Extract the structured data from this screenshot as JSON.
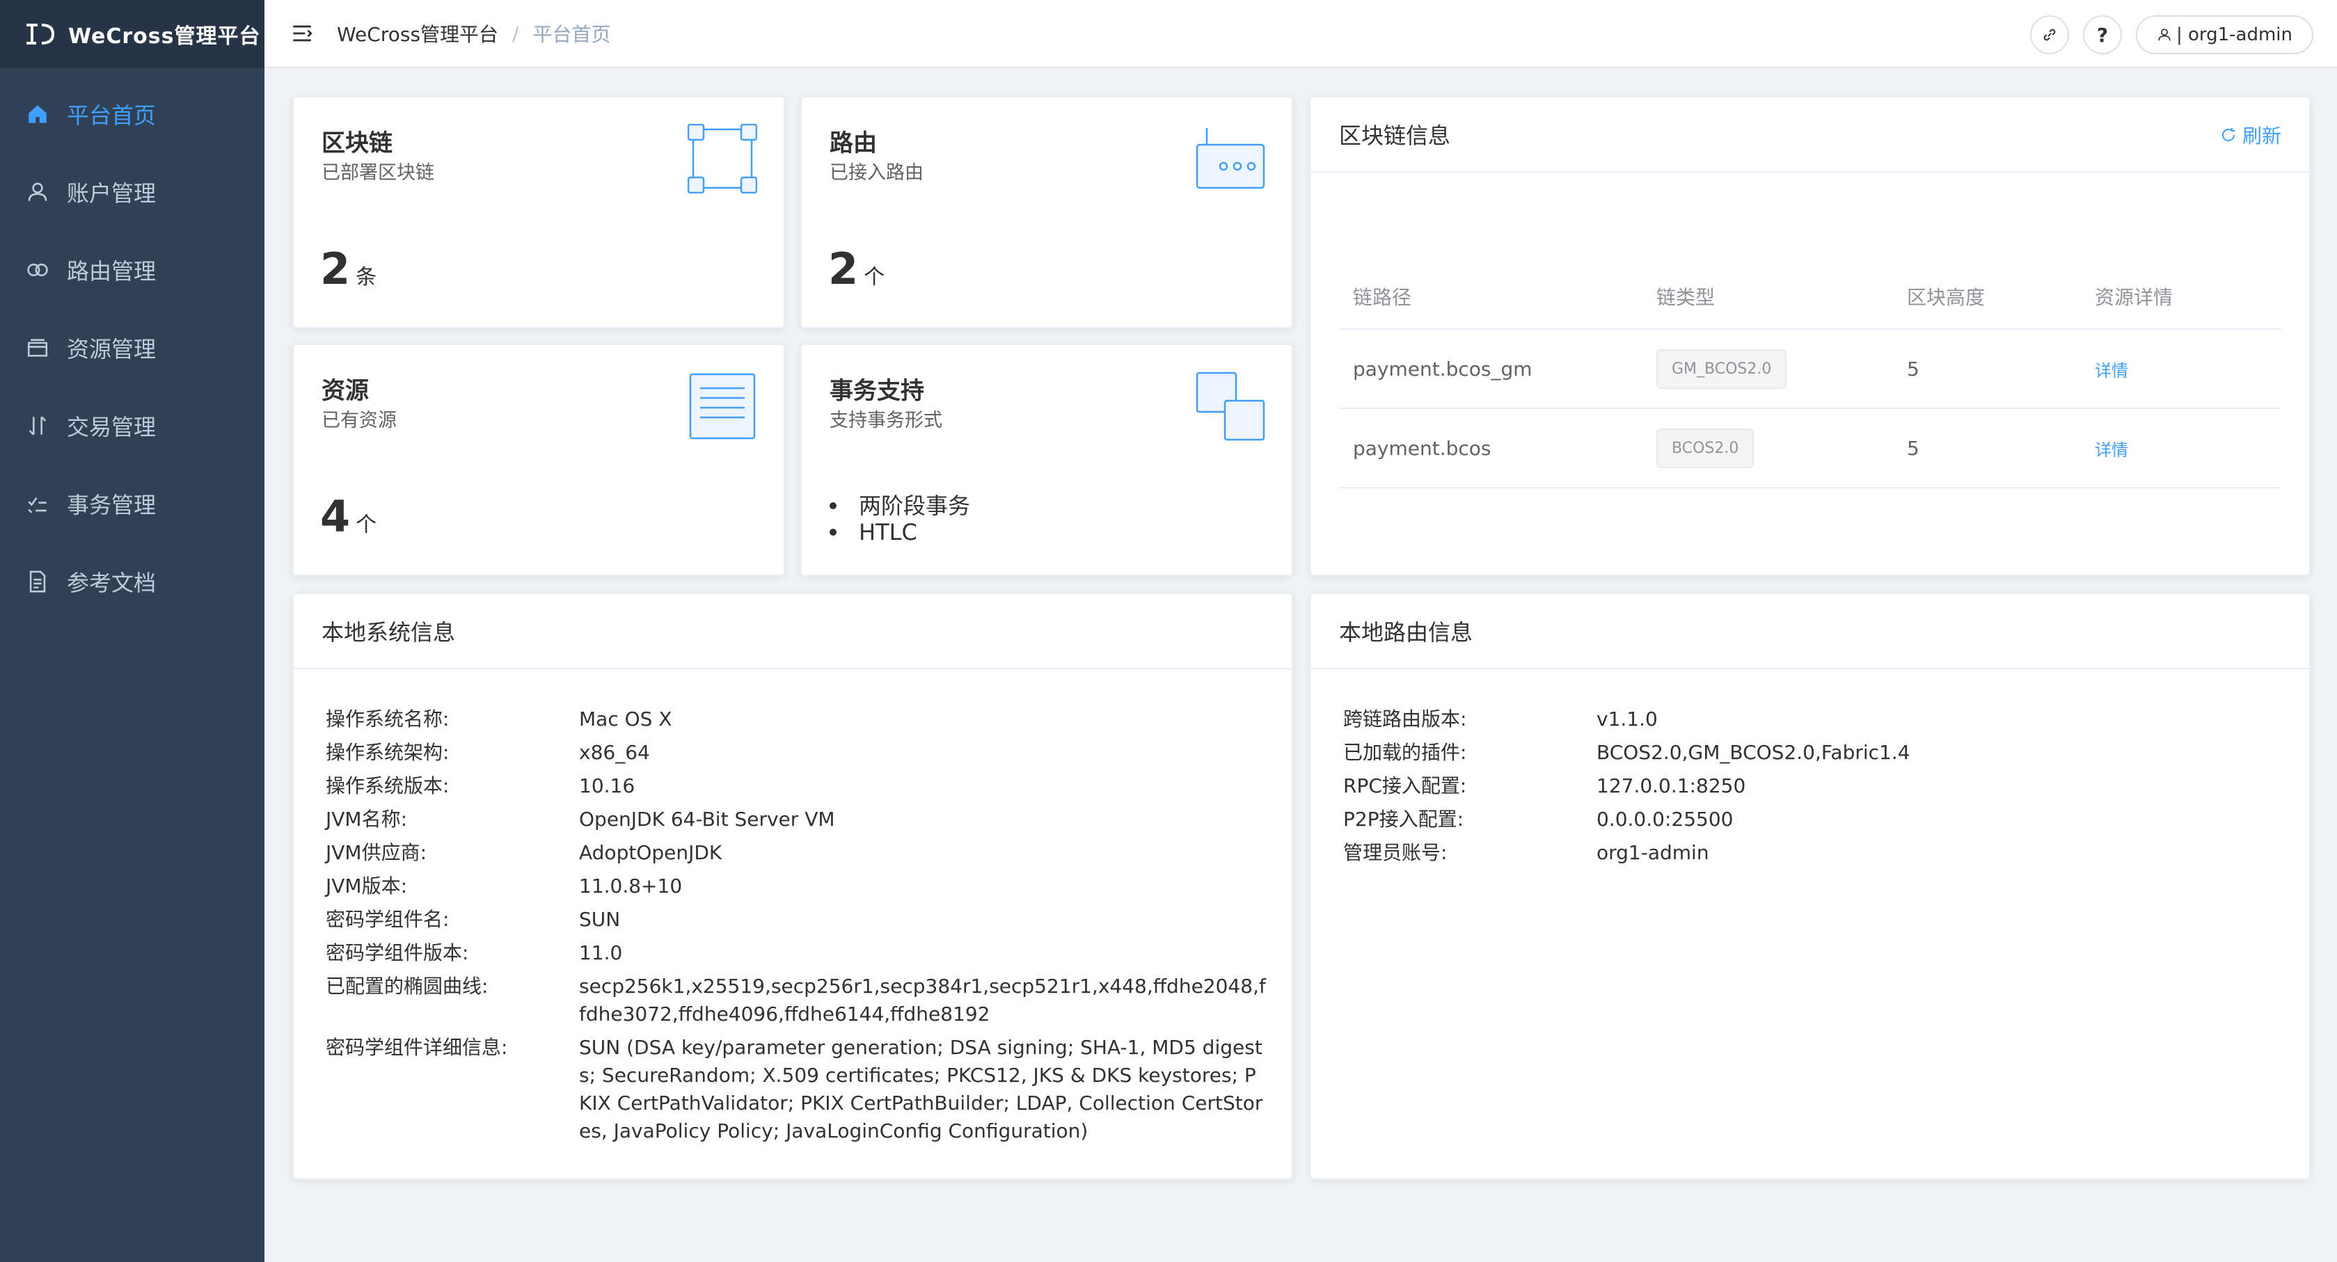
{
  "app": {
    "name": "WeCross管理平台"
  },
  "sidebar": {
    "items": [
      {
        "label": "平台首页",
        "icon": "home-icon",
        "active": true
      },
      {
        "label": "账户管理",
        "icon": "user-icon",
        "active": false
      },
      {
        "label": "路由管理",
        "icon": "router-icon",
        "active": false
      },
      {
        "label": "资源管理",
        "icon": "box-icon",
        "active": false
      },
      {
        "label": "交易管理",
        "icon": "transaction-icon",
        "active": false
      },
      {
        "label": "事务管理",
        "icon": "checklist-icon",
        "active": false
      },
      {
        "label": "参考文档",
        "icon": "document-icon",
        "active": false
      }
    ]
  },
  "header": {
    "breadcrumb": {
      "home": "WeCross管理平台",
      "sep": "/",
      "current": "平台首页"
    },
    "help_label": "?",
    "user_label": "| org1-admin"
  },
  "stats": {
    "chains": {
      "title": "区块链",
      "subtitle": "已部署区块链",
      "value": "2",
      "unit": "条"
    },
    "routers": {
      "title": "路由",
      "subtitle": "已接入路由",
      "value": "2",
      "unit": "个"
    },
    "resources": {
      "title": "资源",
      "subtitle": "已有资源",
      "value": "4",
      "unit": "个"
    },
    "transactions": {
      "title": "事务支持",
      "subtitle": "支持事务形式",
      "items": [
        "两阶段事务",
        "HTLC"
      ]
    }
  },
  "chain_info": {
    "title": "区块链信息",
    "refresh_label": "刷新",
    "columns": [
      "链路径",
      "链类型",
      "区块高度",
      "资源详情"
    ],
    "rows": [
      {
        "path": "payment.bcos_gm",
        "type": "GM_BCOS2.0",
        "height": "5",
        "detail": "详情"
      },
      {
        "path": "payment.bcos",
        "type": "BCOS2.0",
        "height": "5",
        "detail": "详情"
      }
    ]
  },
  "system_info": {
    "title": "本地系统信息",
    "rows": [
      {
        "key": "操作系统名称:",
        "value": "Mac OS X"
      },
      {
        "key": "操作系统架构:",
        "value": "x86_64"
      },
      {
        "key": "操作系统版本:",
        "value": "10.16"
      },
      {
        "key": "JVM名称:",
        "value": "OpenJDK 64-Bit Server VM"
      },
      {
        "key": "JVM供应商:",
        "value": "AdoptOpenJDK"
      },
      {
        "key": "JVM版本:",
        "value": "11.0.8+10"
      },
      {
        "key": "密码学组件名:",
        "value": "SUN"
      },
      {
        "key": "密码学组件版本:",
        "value": "11.0"
      },
      {
        "key": "已配置的椭圆曲线:",
        "value": "secp256k1,x25519,secp256r1,secp384r1,secp521r1,x448,ffdhe2048,ffdhe3072,ffdhe4096,ffdhe6144,ffdhe8192"
      },
      {
        "key": "密码学组件详细信息:",
        "value": "SUN (DSA key/parameter generation; DSA signing; SHA-1, MD5 digests; SecureRandom; X.509 certificates; PKCS12, JKS & DKS keystores; PKIX CertPathValidator; PKIX CertPathBuilder; LDAP, Collection CertStores, JavaPolicy Policy; JavaLoginConfig Configuration)"
      }
    ]
  },
  "router_info": {
    "title": "本地路由信息",
    "rows": [
      {
        "key": "跨链路由版本:",
        "value": "v1.1.0"
      },
      {
        "key": "已加载的插件:",
        "value": "BCOS2.0,GM_BCOS2.0,Fabric1.4"
      },
      {
        "key": "RPC接入配置:",
        "value": "127.0.0.1:8250"
      },
      {
        "key": "P2P接入配置:",
        "value": "0.0.0.0:25500"
      },
      {
        "key": "管理员账号:",
        "value": "org1-admin"
      }
    ]
  },
  "colors": {
    "sidebar_bg": "#304156",
    "logo_bg": "#263445",
    "accent": "#409eff",
    "menu_text": "#bfcbd9"
  }
}
